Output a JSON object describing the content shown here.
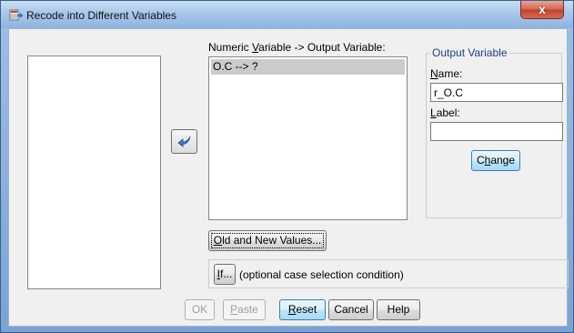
{
  "window": {
    "title": "Recode into Different Variables",
    "close_glyph": "x",
    "title_icon": "recode-icon"
  },
  "source_list": {
    "items": []
  },
  "move_button": {
    "icon": "arrow-left-icon"
  },
  "numeric_var_label": {
    "before": "Numeric ",
    "mnemonic": "V",
    "after": "ariable -> Output Variable:"
  },
  "numeric_var_list": {
    "items": [
      "O.C --> ?"
    ]
  },
  "output_variable": {
    "group_title": "Output Variable",
    "name_label": {
      "mnemonic": "N",
      "rest": "ame:"
    },
    "name_value": "r_O.C",
    "label_label": {
      "mnemonic": "L",
      "rest": "abel:"
    },
    "label_value": "",
    "change_button": {
      "before": "C",
      "mnemonic": "h",
      "after": "ange"
    }
  },
  "old_new_button": {
    "mnemonic": "O",
    "rest": "ld and New Values..."
  },
  "if_button": {
    "mnemonic": "I",
    "rest": "f..."
  },
  "if_description": "(optional case selection condition)",
  "footer_buttons": {
    "ok": "OK",
    "paste": {
      "mnemonic": "P",
      "rest": "aste"
    },
    "reset": {
      "mnemonic": "R",
      "rest": "eset"
    },
    "cancel": "Cancel",
    "help": "Help"
  },
  "colors": {
    "title_gradient_top": "#c9dff5",
    "close_red": "#c0432c",
    "selection_gray": "#cbcbcb",
    "group_title_blue": "#1f3f86"
  }
}
